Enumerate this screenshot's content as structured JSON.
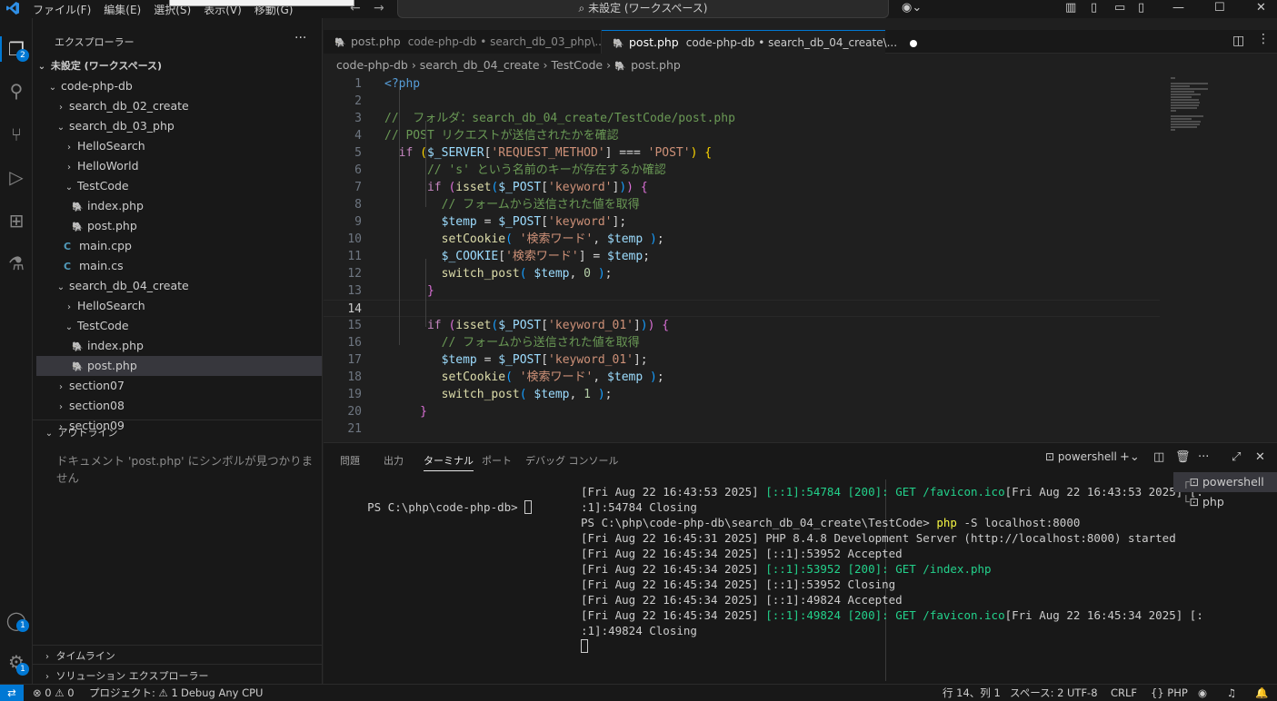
{
  "titlebar": {
    "menus": [
      "ファイル(F)",
      "編集(E)",
      "選択(S)",
      "表示(V)",
      "移動(G)"
    ],
    "search_text": "未設定 (ワークスペース)"
  },
  "activity": {
    "explorer_badge": "2",
    "accounts_badge": "1",
    "manage_badge": "1"
  },
  "sidebar": {
    "title": "エクスプローラー",
    "workspace": "未設定 (ワークスペース)",
    "tree": [
      {
        "label": "code-php-db",
        "kind": "folder-open",
        "indent": 0
      },
      {
        "label": "search_db_02_create",
        "kind": "folder",
        "indent": 1
      },
      {
        "label": "search_db_03_php",
        "kind": "folder-open",
        "indent": 1
      },
      {
        "label": "HelloSearch",
        "kind": "folder",
        "indent": 2
      },
      {
        "label": "HelloWorld",
        "kind": "folder",
        "indent": 2
      },
      {
        "label": "TestCode",
        "kind": "folder-open",
        "indent": 2
      },
      {
        "label": "index.php",
        "kind": "php",
        "indent": 3
      },
      {
        "label": "post.php",
        "kind": "php",
        "indent": 3
      },
      {
        "label": "main.cpp",
        "kind": "cpp",
        "indent": 2
      },
      {
        "label": "main.cs",
        "kind": "cs",
        "indent": 2
      },
      {
        "label": "search_db_04_create",
        "kind": "folder-open",
        "indent": 1
      },
      {
        "label": "HelloSearch",
        "kind": "folder",
        "indent": 2
      },
      {
        "label": "TestCode",
        "kind": "folder-open",
        "indent": 2
      },
      {
        "label": "index.php",
        "kind": "php",
        "indent": 3
      },
      {
        "label": "post.php",
        "kind": "php",
        "indent": 3,
        "selected": true
      },
      {
        "label": "section07",
        "kind": "folder",
        "indent": 1
      },
      {
        "label": "section08",
        "kind": "folder",
        "indent": 1
      },
      {
        "label": "section09",
        "kind": "folder",
        "indent": 1
      }
    ],
    "outline_title": "アウトライン",
    "outline_message": "ドキュメント 'post.php' にシンボルが見つかりません",
    "timeline_title": "タイムライン",
    "solution_title": "ソリューション エクスプローラー"
  },
  "tabs": [
    {
      "label": "post.php",
      "path": "code-php-db • search_db_03_php\\...",
      "active": false
    },
    {
      "label": "post.php",
      "path": "code-php-db • search_db_04_create\\...",
      "active": true
    }
  ],
  "breadcrumb": [
    "code-php-db",
    "search_db_04_create",
    "TestCode",
    "post.php"
  ],
  "editor": {
    "current_line": 14,
    "lines": [
      [
        [
          "tag",
          "<?php"
        ]
      ],
      [],
      [
        [
          "com",
          "//  フォルダ：search_db_04_create/TestCode/post.php"
        ]
      ],
      [
        [
          "com",
          "// POST リクエストが送信されたかを確認"
        ]
      ],
      [
        [
          "pl",
          "  "
        ],
        [
          "kw",
          "if"
        ],
        [
          "pl",
          " "
        ],
        [
          "br1",
          "("
        ],
        [
          "var",
          "$_SERVER"
        ],
        [
          "pl",
          "["
        ],
        [
          "str",
          "'REQUEST_METHOD'"
        ],
        [
          "pl",
          "] === "
        ],
        [
          "str",
          "'POST'"
        ],
        [
          "br1",
          ")"
        ],
        [
          "pl",
          " "
        ],
        [
          "br1",
          "{"
        ]
      ],
      [
        [
          "pl",
          "      "
        ],
        [
          "com",
          "// 's' という名前のキーが存在するか確認"
        ]
      ],
      [
        [
          "pl",
          "      "
        ],
        [
          "kw",
          "if"
        ],
        [
          "pl",
          " "
        ],
        [
          "br2",
          "("
        ],
        [
          "fn",
          "isset"
        ],
        [
          "br3",
          "("
        ],
        [
          "var",
          "$_POST"
        ],
        [
          "pl",
          "["
        ],
        [
          "str",
          "'keyword'"
        ],
        [
          "pl",
          "]"
        ],
        [
          "br3",
          ")"
        ],
        [
          "br2",
          ")"
        ],
        [
          "pl",
          " "
        ],
        [
          "br2",
          "{"
        ]
      ],
      [
        [
          "pl",
          "        "
        ],
        [
          "com",
          "// フォームから送信された値を取得"
        ]
      ],
      [
        [
          "pl",
          "        "
        ],
        [
          "var",
          "$temp"
        ],
        [
          "pl",
          " = "
        ],
        [
          "var",
          "$_POST"
        ],
        [
          "pl",
          "["
        ],
        [
          "str",
          "'keyword'"
        ],
        [
          "pl",
          "];"
        ]
      ],
      [
        [
          "pl",
          "        "
        ],
        [
          "fn",
          "setCookie"
        ],
        [
          "br3",
          "("
        ],
        [
          "str",
          " '検索ワード'"
        ],
        [
          "pl",
          ", "
        ],
        [
          "var",
          "$temp"
        ],
        [
          "pl",
          " "
        ],
        [
          "br3",
          ")"
        ],
        [
          "pl",
          ";"
        ]
      ],
      [
        [
          "pl",
          "        "
        ],
        [
          "var",
          "$_COOKIE"
        ],
        [
          "pl",
          "["
        ],
        [
          "str",
          "'検索ワード'"
        ],
        [
          "pl",
          "] = "
        ],
        [
          "var",
          "$temp"
        ],
        [
          "pl",
          ";"
        ]
      ],
      [
        [
          "pl",
          "        "
        ],
        [
          "fn",
          "switch_post"
        ],
        [
          "br3",
          "("
        ],
        [
          "pl",
          " "
        ],
        [
          "var",
          "$temp"
        ],
        [
          "pl",
          ", "
        ],
        [
          "num",
          "0"
        ],
        [
          "pl",
          " "
        ],
        [
          "br3",
          ")"
        ],
        [
          "pl",
          ";"
        ]
      ],
      [
        [
          "pl",
          "      "
        ],
        [
          "br2",
          "}"
        ]
      ],
      [],
      [
        [
          "pl",
          "      "
        ],
        [
          "kw",
          "if"
        ],
        [
          "pl",
          " "
        ],
        [
          "br2",
          "("
        ],
        [
          "fn",
          "isset"
        ],
        [
          "br3",
          "("
        ],
        [
          "var",
          "$_POST"
        ],
        [
          "pl",
          "["
        ],
        [
          "str",
          "'keyword_01'"
        ],
        [
          "pl",
          "]"
        ],
        [
          "br3",
          ")"
        ],
        [
          "br2",
          ")"
        ],
        [
          "pl",
          " "
        ],
        [
          "br2",
          "{"
        ]
      ],
      [
        [
          "pl",
          "        "
        ],
        [
          "com",
          "// フォームから送信された値を取得"
        ]
      ],
      [
        [
          "pl",
          "        "
        ],
        [
          "var",
          "$temp"
        ],
        [
          "pl",
          " = "
        ],
        [
          "var",
          "$_POST"
        ],
        [
          "pl",
          "["
        ],
        [
          "str",
          "'keyword_01'"
        ],
        [
          "pl",
          "];"
        ]
      ],
      [
        [
          "pl",
          "        "
        ],
        [
          "fn",
          "setCookie"
        ],
        [
          "br3",
          "("
        ],
        [
          "str",
          " '検索ワード'"
        ],
        [
          "pl",
          ", "
        ],
        [
          "var",
          "$temp"
        ],
        [
          "pl",
          " "
        ],
        [
          "br3",
          ")"
        ],
        [
          "pl",
          ";"
        ]
      ],
      [
        [
          "pl",
          "        "
        ],
        [
          "fn",
          "switch_post"
        ],
        [
          "br3",
          "("
        ],
        [
          "pl",
          " "
        ],
        [
          "var",
          "$temp"
        ],
        [
          "pl",
          ", "
        ],
        [
          "num",
          "1"
        ],
        [
          "pl",
          " "
        ],
        [
          "br3",
          ")"
        ],
        [
          "pl",
          ";"
        ]
      ],
      [
        [
          "pl",
          "     "
        ],
        [
          "br2",
          "}"
        ]
      ],
      []
    ]
  },
  "panel": {
    "tabs": [
      "問題",
      "出力",
      "ターミナル",
      "ポート",
      "デバッグ コンソール"
    ],
    "active_tab": "ターミナル",
    "terminal_name": "powershell",
    "left_prompt": "PS C:\\php\\code-php-db> ",
    "right_lines": [
      [
        [
          "pl",
          "[Fri Aug 22 16:43:53 2025] "
        ],
        [
          "g",
          "[::1]:54784 [200]: GET /favicon.ico"
        ],
        [
          "pl",
          "[Fri Aug 22 16:43:53 2025] [:"
        ]
      ],
      [
        [
          "pl",
          ":1]:54784 Closing"
        ]
      ],
      [
        [
          "pl",
          "PS C:\\php\\code-php-db\\search_db_04_create\\TestCode> "
        ],
        [
          "y",
          "php"
        ],
        [
          "pl",
          " -S localhost:8000"
        ]
      ],
      [
        [
          "pl",
          "[Fri Aug 22 16:45:31 2025] PHP 8.4.8 Development Server (http://localhost:8000) started"
        ]
      ],
      [
        [
          "pl",
          "[Fri Aug 22 16:45:34 2025] [::1]:53952 Accepted"
        ]
      ],
      [
        [
          "pl",
          "[Fri Aug 22 16:45:34 2025] "
        ],
        [
          "g",
          "[::1]:53952 [200]: GET /index.php"
        ]
      ],
      [
        [
          "pl",
          "[Fri Aug 22 16:45:34 2025] [::1]:53952 Closing"
        ]
      ],
      [
        [
          "pl",
          "[Fri Aug 22 16:45:34 2025] [::1]:49824 Accepted"
        ]
      ],
      [
        [
          "pl",
          "[Fri Aug 22 16:45:34 2025] "
        ],
        [
          "g",
          "[::1]:49824 [200]: GET /favicon.ico"
        ],
        [
          "pl",
          "[Fri Aug 22 16:45:34 2025] [:"
        ]
      ],
      [
        [
          "pl",
          ":1]:49824 Closing"
        ]
      ]
    ],
    "terminal_list": [
      "powershell",
      "php"
    ]
  },
  "statusbar": {
    "errors": "0",
    "warnings": "0",
    "project": "プロジェクト: ⚠ 1",
    "debug": "Debug Any CPU",
    "position": "行 14、列 1",
    "spaces": "スペース: 2",
    "encoding": "UTF-8",
    "eol": "CRLF",
    "language": "PHP"
  }
}
